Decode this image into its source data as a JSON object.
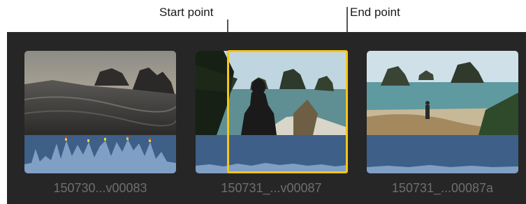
{
  "callouts": {
    "start": "Start point",
    "end": "End point"
  },
  "clips": [
    {
      "name": "150730...v00083",
      "selected": false
    },
    {
      "name": "150731_...v00087",
      "selected": true
    },
    {
      "name": "150731_...00087a",
      "selected": false
    }
  ],
  "colors": {
    "browser_bg": "#262626",
    "waveform": "#3e5f87",
    "selection": "#f5c51a",
    "clip_name": "#6e6e6e"
  },
  "icons": [
    "start-leader-line",
    "end-leader-line"
  ]
}
